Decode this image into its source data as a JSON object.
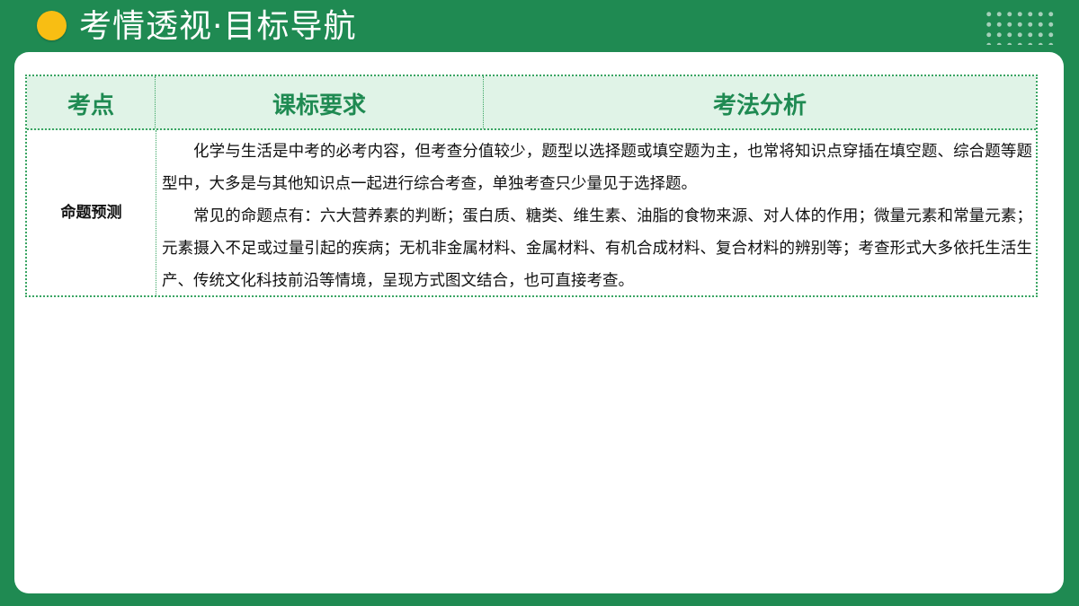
{
  "header": {
    "title": "考情透视·目标导航"
  },
  "table": {
    "columns": [
      "考点",
      "课标要求",
      "考法分析"
    ],
    "row": {
      "label": "命题预测",
      "paragraphs": [
        "化学与生活是中考的必考内容，但考查分值较少，题型以选择题或填空题为主，也常将知识点穿插在填空题、综合题等题型中，大多是与其他知识点一起进行综合考查，单独考查只少量见于选择题。",
        "常见的命题点有：六大营养素的判断；蛋白质、糖类、维生素、油脂的食物来源、对人体的作用；微量元素和常量元素；元素摄入不足或过量引起的疾病；无机非金属材料、金属材料、有机合成材料、复合材料的辨别等；考查形式大多依托生活生产、传统文化科技前沿等情境，呈现方式图文结合，也可直接考查。"
      ]
    }
  },
  "colors": {
    "background": "#1f8a52",
    "accent_dot": "#f8be13",
    "header_fill": "#e0f3e7",
    "header_text": "#1f8a52",
    "card": "#ffffff"
  }
}
